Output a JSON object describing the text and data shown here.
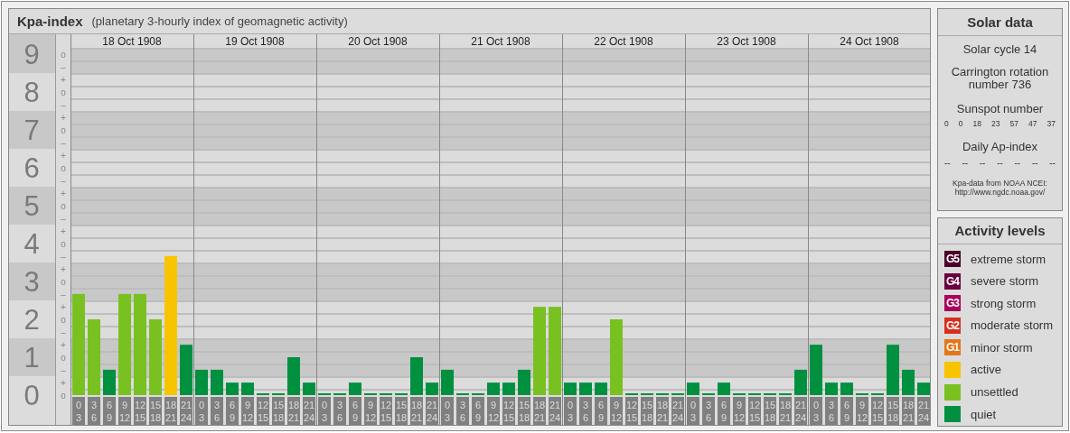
{
  "kpa_panel": {
    "title": "Kpa-index",
    "subtitle": "(planetary 3-hourly index of geomagnetic activity)",
    "days": [
      "18 Oct 1908",
      "19 Oct 1908",
      "20 Oct 1908",
      "21 Oct 1908",
      "22 Oct 1908",
      "23 Oct 1908",
      "24 Oct 1908"
    ],
    "scale_marks": [
      "o",
      "–",
      "+",
      "o",
      "–",
      "+",
      "o",
      "–",
      "+",
      "o",
      "–",
      "+",
      "o",
      "–",
      "+",
      "o",
      "–",
      "+",
      "o",
      "–",
      "+",
      "o",
      "–",
      "+",
      "o",
      "–",
      "+",
      "o"
    ],
    "chart_data": {
      "type": "bar",
      "ylim": [
        0,
        9.52
      ],
      "grid": true,
      "yticks": [
        {
          "value": 0,
          "label": "0"
        },
        {
          "value": 1,
          "label": "1"
        },
        {
          "value": 2,
          "label": "2"
        },
        {
          "value": 3,
          "label": "3"
        },
        {
          "value": 4,
          "label": "4"
        },
        {
          "value": 5,
          "label": "5"
        },
        {
          "value": 6,
          "label": "6"
        },
        {
          "value": 7,
          "label": "7"
        },
        {
          "value": 8,
          "label": "8"
        },
        {
          "value": 9,
          "label": "9"
        }
      ],
      "categories": [
        "0\n3",
        "3\n6",
        "6\n9",
        "9\n12",
        "12\n15",
        "15\n18",
        "18\n21",
        "21\n24",
        "0\n3",
        "3\n6",
        "6\n9",
        "9\n12",
        "12\n15",
        "15\n18",
        "18\n21",
        "21\n24",
        "0\n3",
        "3\n6",
        "6\n9",
        "9\n12",
        "12\n15",
        "15\n18",
        "18\n21",
        "21\n24",
        "0\n3",
        "3\n6",
        "6\n9",
        "9\n12",
        "12\n15",
        "15\n18",
        "18\n21",
        "21\n24",
        "0\n3",
        "3\n6",
        "6\n9",
        "9\n12",
        "12\n15",
        "15\n18",
        "18\n21",
        "21\n24",
        "0\n3",
        "3\n6",
        "6\n9",
        "9\n12",
        "12\n15",
        "15\n18",
        "18\n21",
        "21\n24",
        "0\n3",
        "3\n6",
        "6\n9",
        "9\n12",
        "12\n15",
        "15\n18",
        "18\n21",
        "21\n24"
      ],
      "values": [
        2.67,
        2,
        0.67,
        2.67,
        2.67,
        2,
        3.67,
        1.33,
        0.67,
        0.67,
        0.33,
        0.33,
        0,
        0,
        1,
        0.33,
        0,
        0,
        0.33,
        0,
        0,
        0,
        1,
        0.33,
        0.67,
        0,
        0,
        0.33,
        0.33,
        0.67,
        2.33,
        2.33,
        0.33,
        0.33,
        0.33,
        2,
        0,
        0,
        0,
        0,
        0.33,
        0,
        0.33,
        0,
        0,
        0,
        0,
        0.67,
        1.33,
        0.33,
        0.33,
        0,
        0,
        1.33,
        0.67,
        0.33
      ]
    }
  },
  "solar_data": {
    "title": "Solar data",
    "solar_cycle": "Solar cycle 14",
    "carrington": "Carrington rotation number 736",
    "sunspot_label": "Sunspot number",
    "sunspot_numbers": [
      "0",
      "0",
      "18",
      "23",
      "57",
      "47",
      "37"
    ],
    "ap_label": "Daily Ap-index",
    "ap_values": [
      "--",
      "--",
      "--",
      "--",
      "--",
      "--",
      "--"
    ],
    "source_note": "Kpa-data from NOAA NCEI:",
    "source_url": "http://www.ngdc.noaa.gov/"
  },
  "activity_levels": {
    "title": "Activity levels",
    "items": [
      {
        "badge": "G5",
        "label": "extreme storm",
        "color": "#4a0028"
      },
      {
        "badge": "G4",
        "label": "severe storm",
        "color": "#6c003f"
      },
      {
        "badge": "G3",
        "label": "strong storm",
        "color": "#a8005c"
      },
      {
        "badge": "G2",
        "label": "moderate storm",
        "color": "#d8301e"
      },
      {
        "badge": "G1",
        "label": "minor storm",
        "color": "#e5761a"
      },
      {
        "label": "active",
        "color": "#f8c400"
      },
      {
        "label": "unsettled",
        "color": "#79c120"
      },
      {
        "label": "quiet",
        "color": "#009040"
      }
    ]
  }
}
